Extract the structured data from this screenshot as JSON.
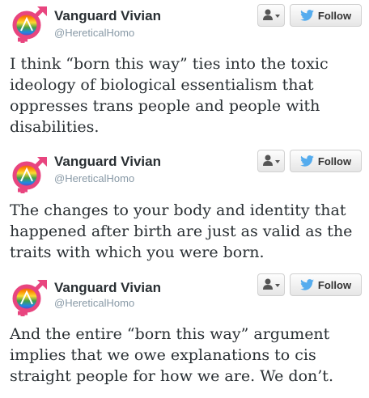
{
  "tweets": [
    {
      "name": "Vanguard Vivian",
      "handle": "@HereticalHomo",
      "follow_label": "Follow",
      "text": "I think “born this way” ties into the toxic ideology of biological essentialism that oppresses trans people and people with disabilities."
    },
    {
      "name": "Vanguard Vivian",
      "handle": "@HereticalHomo",
      "follow_label": "Follow",
      "text": "The changes to your body and identity that happened after birth are just as valid as the traits with which you were born."
    },
    {
      "name": "Vanguard Vivian",
      "handle": "@HereticalHomo",
      "follow_label": "Follow",
      "text": "And the entire “born this way” argument implies that we owe explanations to cis straight people for how we are. We don’t."
    }
  ],
  "icons": {
    "avatar": "rainbow-gender-symbol-avatar",
    "user_dropdown": "user-silhouette-icon",
    "dropdown_caret": "caret-down-icon",
    "follow": "twitter-bird-icon"
  },
  "colors": {
    "avatar_ring": "#e8457f",
    "twitter_blue": "#55acee",
    "handle_gray": "#8899a6"
  }
}
